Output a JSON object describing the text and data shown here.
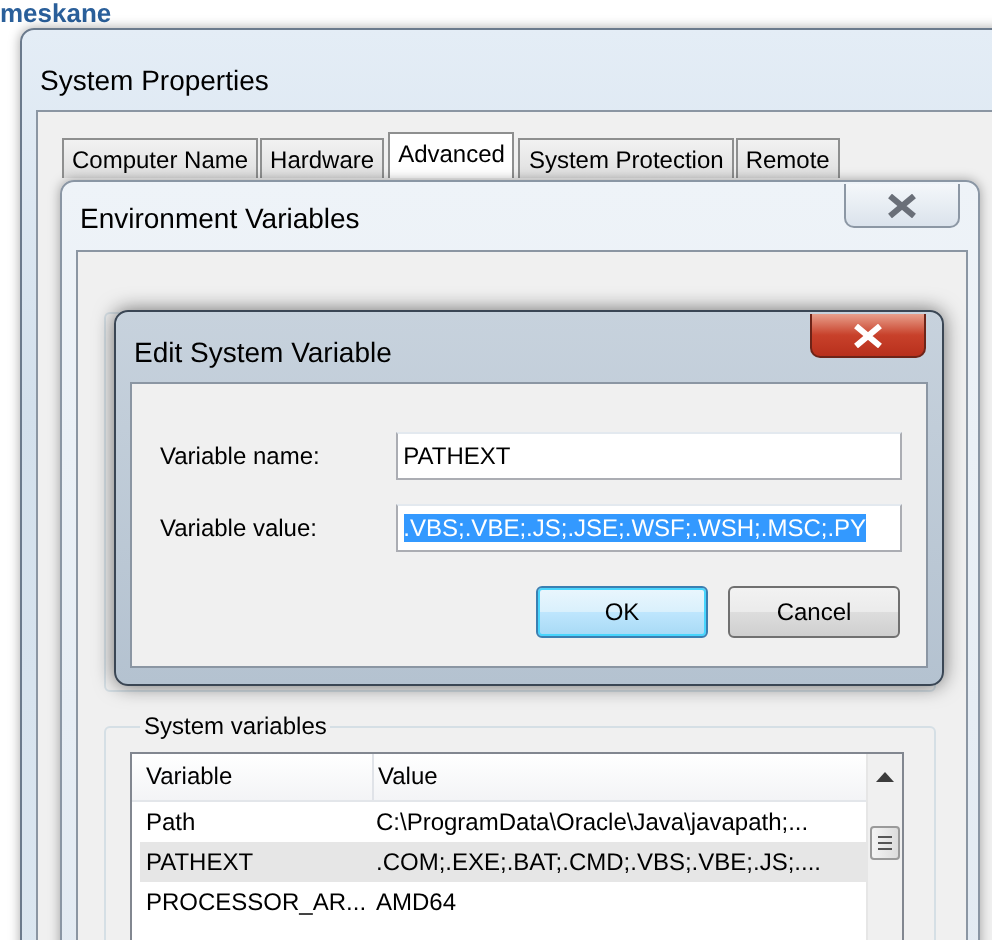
{
  "background_page": {
    "heading": "meskane"
  },
  "system_properties": {
    "title": "System Properties",
    "tabs": [
      {
        "label": "Computer Name",
        "selected": false
      },
      {
        "label": "Hardware",
        "selected": false
      },
      {
        "label": "Advanced",
        "selected": true
      },
      {
        "label": "System Protection",
        "selected": false
      },
      {
        "label": "Remote",
        "selected": false
      }
    ]
  },
  "environment_variables": {
    "title": "Environment Variables",
    "system_variables": {
      "label": "System variables",
      "columns": [
        "Variable",
        "Value"
      ],
      "rows": [
        {
          "variable": "Path",
          "value": "C:\\ProgramData\\Oracle\\Java\\javapath;...",
          "selected": false
        },
        {
          "variable": "PATHEXT",
          "value": ".COM;.EXE;.BAT;.CMD;.VBS;.VBE;.JS;....",
          "selected": true
        },
        {
          "variable": "PROCESSOR_AR...",
          "value": "AMD64",
          "selected": false
        }
      ]
    }
  },
  "edit_dialog": {
    "title": "Edit System Variable",
    "fields": [
      {
        "label": "Variable name:",
        "value": "PATHEXT",
        "selected": false
      },
      {
        "label": "Variable value:",
        "value": ".VBS;.VBE;.JS;.JSE;.WSF;.WSH;.MSC;.PY",
        "selected": true
      }
    ],
    "buttons": [
      {
        "label": "OK",
        "default": true
      },
      {
        "label": "Cancel",
        "default": false
      }
    ]
  }
}
